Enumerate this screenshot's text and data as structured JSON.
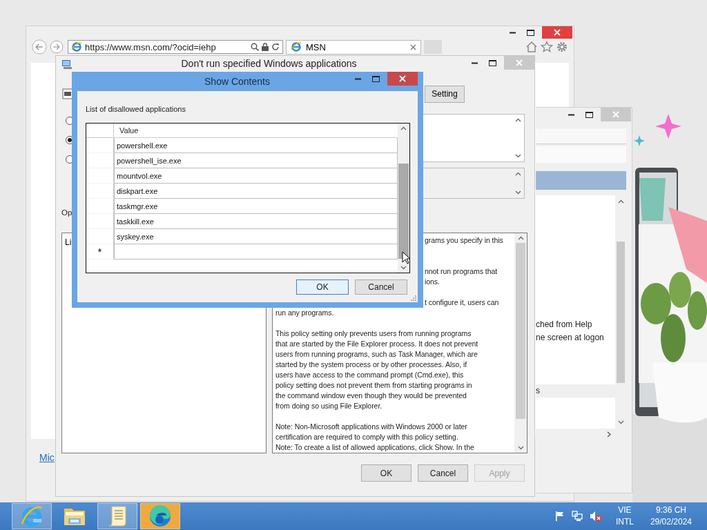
{
  "browser": {
    "address": "https://www.msn.com/?ocid=iehp",
    "tab": {
      "title": "MSN"
    },
    "link": "Mic"
  },
  "side_window": {
    "texts": [
      "ched from Help",
      "ne screen at logon",
      "s"
    ]
  },
  "policy_window": {
    "title": "Don't run specified Windows applications",
    "setting_button": "Setting",
    "radios": [
      {
        "selected": false
      },
      {
        "selected": true
      },
      {
        "selected": false
      }
    ],
    "options_label": "Op",
    "options_text": "Li",
    "help_lines": [
      {
        "kind": "partial",
        "text": "grams you specify in this"
      },
      {
        "kind": "gap"
      },
      {
        "kind": "gap"
      },
      {
        "kind": "partial",
        "text": "nnot run programs that"
      },
      {
        "kind": "partial",
        "text": "ions."
      },
      {
        "kind": "gap"
      },
      {
        "kind": "partial",
        "text": "t configure it, users can"
      },
      {
        "kind": "line",
        "text": "run any programs."
      },
      {
        "kind": "gap"
      },
      {
        "kind": "line",
        "text": "This policy setting only prevents users from running programs"
      },
      {
        "kind": "line",
        "text": "that are started by the File Explorer process. It does not prevent"
      },
      {
        "kind": "line",
        "text": "users from running programs, such as Task Manager, which are"
      },
      {
        "kind": "line",
        "text": "started by the system process or by other processes.  Also, if"
      },
      {
        "kind": "line",
        "text": "users have access to the command prompt (Cmd.exe), this"
      },
      {
        "kind": "line",
        "text": "policy setting does not prevent them from starting programs in"
      },
      {
        "kind": "line",
        "text": "the command window even though they would be prevented"
      },
      {
        "kind": "line",
        "text": "from doing so using File Explorer."
      },
      {
        "kind": "gap"
      },
      {
        "kind": "line",
        "text": "Note: Non-Microsoft applications with Windows 2000 or later"
      },
      {
        "kind": "line",
        "text": "certification are required to comply with this policy setting."
      },
      {
        "kind": "line",
        "text": "Note: To create a list of allowed applications, click Show.  In the"
      }
    ],
    "buttons": [
      {
        "label": "OK",
        "disabled": false
      },
      {
        "label": "Cancel",
        "disabled": false
      },
      {
        "label": "Apply",
        "disabled": true
      }
    ]
  },
  "show_contents": {
    "title": "Show Contents",
    "label": "List of disallowed applications",
    "column": "Value",
    "rows": [
      "powershell.exe",
      "powershell_ise.exe",
      "mountvol.exe",
      "diskpart.exe",
      "taskmgr.exe",
      "taskkill.exe",
      "syskey.exe"
    ],
    "new_row_marker": "*",
    "buttons": [
      {
        "label": "OK",
        "default": true
      },
      {
        "label": "Cancel",
        "default": false
      }
    ]
  },
  "taskbar": {
    "apps": [
      {
        "kind": "ie",
        "highlighted": true,
        "flashing": false
      },
      {
        "kind": "folder",
        "highlighted": false,
        "flashing": false
      },
      {
        "kind": "notepad",
        "highlighted": true,
        "flashing": false
      },
      {
        "kind": "edge",
        "highlighted": false,
        "flashing": true
      }
    ],
    "volume_muted": true,
    "language": "VIE",
    "layout": "INTL",
    "time": "9:36 CH",
    "date": "29/02/2024"
  }
}
